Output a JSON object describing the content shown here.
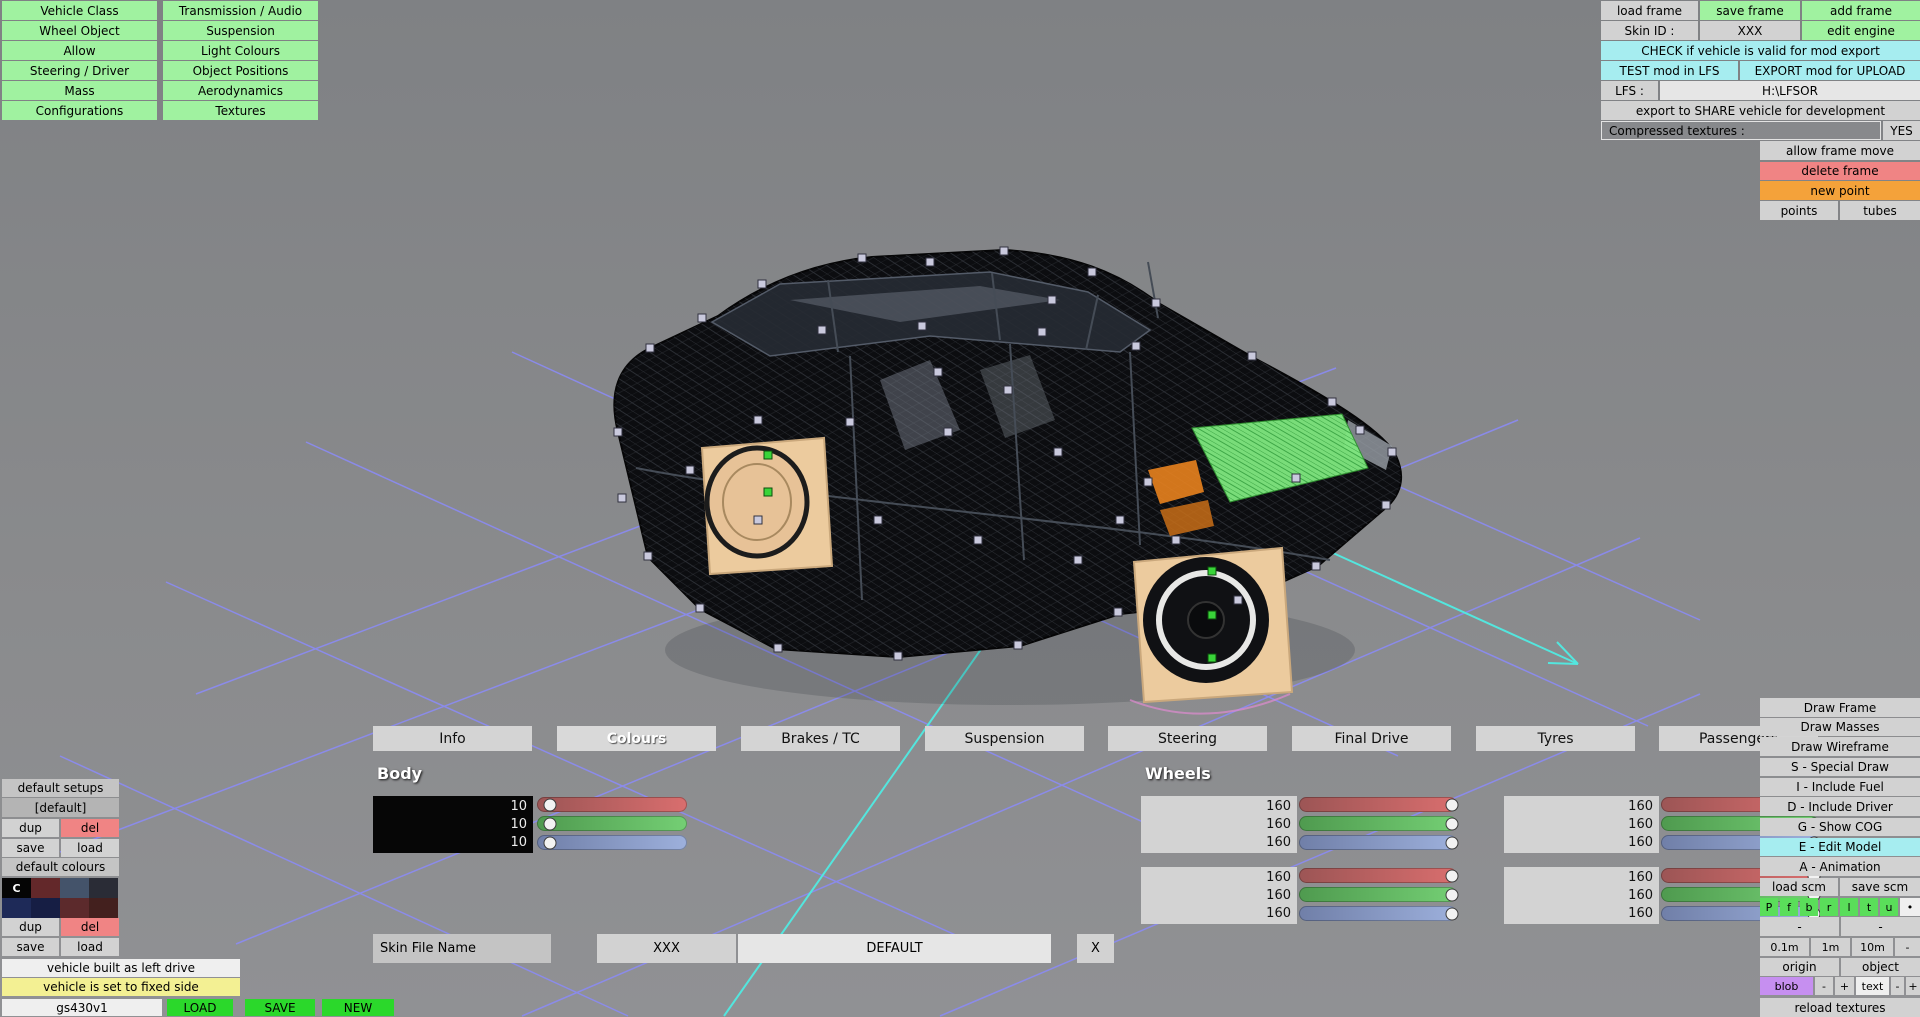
{
  "menu": {
    "items_left": [
      "Vehicle Class",
      "Wheel Object",
      "Allow",
      "Steering / Driver",
      "Mass",
      "Configurations"
    ],
    "items_right": [
      "Transmission / Audio",
      "Suspension",
      "Light Colours",
      "Object Positions",
      "Aerodynamics",
      "Textures"
    ]
  },
  "frame_bar": {
    "load_frame": "load frame",
    "save_frame": "save frame",
    "add_frame": "add frame",
    "skin_id_label": "Skin ID :",
    "skin_id_value": "XXX",
    "edit_engine": "edit engine"
  },
  "export_bar": {
    "check": "CHECK if vehicle is valid for mod export",
    "test": "TEST mod in LFS",
    "export_upload": "EXPORT mod for UPLOAD",
    "lfs_label": "LFS :",
    "lfs_path": "H:\\LFSOR",
    "share": "export to SHARE vehicle for development",
    "compressed_label": "Compressed textures :",
    "compressed_value": "YES"
  },
  "frame_tools": {
    "allow_move": "allow frame move",
    "delete_frame": "delete frame",
    "new_point": "new point",
    "points": "points",
    "tubes": "tubes"
  },
  "tabs": {
    "items": [
      "Info",
      "Colours",
      "Brakes / TC",
      "Suspension",
      "Steering",
      "Final Drive",
      "Tyres",
      "Passengers"
    ],
    "selected": "Colours"
  },
  "colours_tab": {
    "body": {
      "label": "Body",
      "r": 10,
      "g": 10,
      "b": 10,
      "swatch": "#060606"
    },
    "wheels": {
      "label": "Wheels",
      "groups": [
        {
          "r": 160,
          "g": 160,
          "b": 160,
          "swatch": "#d3d3d3"
        },
        {
          "r": 160,
          "g": 160,
          "b": 160,
          "swatch": "#d3d3d3"
        },
        {
          "r": 160,
          "g": 160,
          "b": 160,
          "swatch": "#d3d3d3"
        },
        {
          "r": 160,
          "g": 160,
          "b": 160,
          "swatch": "#d3d3d3"
        }
      ]
    }
  },
  "skin_file": {
    "label": "Skin File Name",
    "id": "XXX",
    "name": "DEFAULT",
    "clear": "X"
  },
  "setups": {
    "header": "default setups",
    "selected": "[default]",
    "dup": "dup",
    "del": "del",
    "save": "save",
    "load": "load",
    "colours_header": "default colours",
    "current_marker": "C",
    "palette": [
      "#050505",
      "#63282a",
      "#44536a",
      "#2a2c36",
      "#1e2a58",
      "#161e44",
      "#5c2a2c",
      "#43201e"
    ]
  },
  "vehicle": {
    "left_drive": "vehicle built as left drive",
    "fixed_side": "vehicle is set to fixed side",
    "name": "gs430v1",
    "load": "LOAD",
    "save": "SAVE",
    "new": "NEW"
  },
  "view_panel": {
    "rows": [
      "Draw Frame",
      "Draw Masses",
      "Draw Wireframe",
      "S - Special Draw",
      "I - Include Fuel",
      "D - Include Driver",
      "G - Show COG",
      "E - Edit Model",
      "A - Animation"
    ],
    "load_scm": "load scm",
    "save_scm": "save scm",
    "letters": [
      "P",
      "f",
      "b",
      "r",
      "l",
      "t",
      "u",
      "•"
    ],
    "dash": "-",
    "plus": "+",
    "scales": [
      "0.1m",
      "1m",
      "10m",
      "-"
    ],
    "origin": "origin",
    "object": "object",
    "blob": "blob",
    "text": "text",
    "reload": "reload textures"
  },
  "colors": {
    "button_green": "#a0f2a0",
    "button_cyan": "#a6edf0",
    "button_red": "#f08484",
    "button_orange": "#f4a23a",
    "button_yellow": "#f3f093",
    "bright_green": "#2bd82b",
    "blob_purple": "#c68ff0",
    "grid_line": "#8b8bf4",
    "axis_cyan": "#53e6de"
  }
}
